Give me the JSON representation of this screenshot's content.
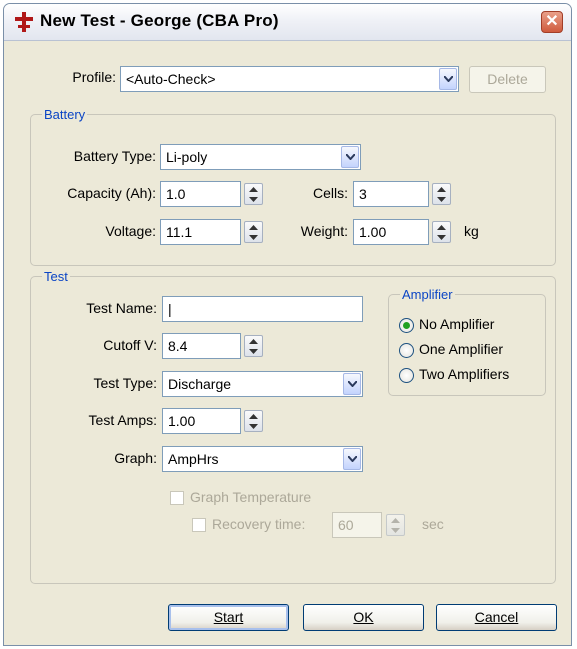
{
  "window": {
    "title": "New Test - George (CBA Pro)"
  },
  "profile": {
    "label": "Profile:",
    "value": "<Auto-Check>",
    "delete_label": "Delete"
  },
  "battery": {
    "legend": "Battery",
    "type_label": "Battery Type:",
    "type_value": "Li-poly",
    "capacity_label": "Capacity (Ah):",
    "capacity_value": "1.0",
    "cells_label": "Cells:",
    "cells_value": "3",
    "voltage_label": "Voltage:",
    "voltage_value": "11.1",
    "weight_label": "Weight:",
    "weight_value": "1.00",
    "weight_unit": "kg"
  },
  "test": {
    "legend": "Test",
    "name_label": "Test Name:",
    "name_value": "|",
    "cutoff_label": "Cutoff V:",
    "cutoff_value": "8.4",
    "type_label": "Test Type:",
    "type_value": "Discharge",
    "amps_label": "Test Amps:",
    "amps_value": "1.00",
    "graph_label": "Graph:",
    "graph_value": "AmpHrs",
    "graph_temp_label": "Graph Temperature",
    "recovery_label": "Recovery time:",
    "recovery_value": "60",
    "recovery_unit": "sec"
  },
  "amplifier": {
    "legend": "Amplifier",
    "options": [
      "No Amplifier",
      "One Amplifier",
      "Two Amplifiers"
    ],
    "selected": "No Amplifier"
  },
  "buttons": {
    "start": "Start",
    "ok": "OK",
    "cancel": "Cancel"
  }
}
